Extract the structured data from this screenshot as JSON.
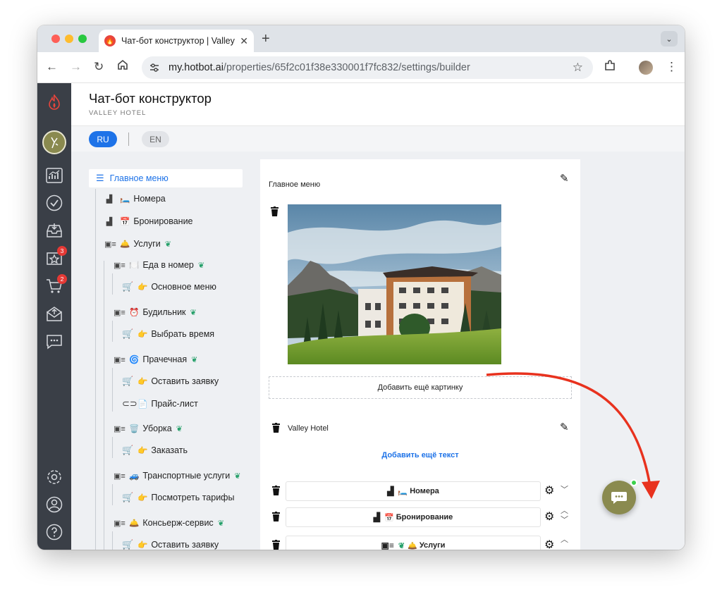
{
  "browser": {
    "tab_title": "Чат-бот конструктор | Valley",
    "url_host": "my.hotbot.ai",
    "url_path": "/properties/65f2c01f38e330001f7fc832/settings/builder"
  },
  "sidebar": {
    "badges": {
      "favorites": "3",
      "cart": "2"
    }
  },
  "header": {
    "title": "Чат-бот конструктор",
    "subtitle": "VALLEY HOTEL"
  },
  "languages": {
    "active": "RU",
    "inactive": "EN"
  },
  "tree": {
    "root": "Главное меню",
    "items": [
      {
        "emoji": "🛏️",
        "label": "Номера"
      },
      {
        "emoji": "📅",
        "label": "Бронирование"
      },
      {
        "emoji": "🛎️",
        "label": "Услуги"
      },
      {
        "emoji": "🍽️",
        "label": "Еда в номер"
      },
      {
        "emoji": "👉",
        "label": "Основное меню"
      },
      {
        "emoji": "⏰",
        "label": "Будильник"
      },
      {
        "emoji": "👉",
        "label": "Выбрать время"
      },
      {
        "emoji": "🌀",
        "label": "Прачечная"
      },
      {
        "emoji": "👉",
        "label": "Оставить заявку"
      },
      {
        "emoji": "📄",
        "label": "Прайс-лист"
      },
      {
        "emoji": "🗑️",
        "label": "Уборка"
      },
      {
        "emoji": "👉",
        "label": "Заказать"
      },
      {
        "emoji": "🚙",
        "label": "Транспортные услуги"
      },
      {
        "emoji": "👉",
        "label": "Посмотреть тарифы"
      },
      {
        "emoji": "🛎️",
        "label": "Консьерж-сервис"
      },
      {
        "emoji": "👉",
        "label": "Оставить заявку"
      }
    ]
  },
  "editor": {
    "title": "Главное меню",
    "add_image": "Добавить ещё картинку",
    "text_block": "Valley Hotel",
    "add_text": "Добавить ещё текст",
    "buttons": [
      {
        "emoji": "🛏️",
        "label": "Номера"
      },
      {
        "emoji": "📅",
        "label": "Бронирование"
      },
      {
        "emoji": "🛎️",
        "label": "Услуги"
      }
    ]
  },
  "colors": {
    "accent": "#1e73e8",
    "sidebar": "#3a3f47",
    "chat_fab": "#8a8a4f",
    "annotation_arrow": "#e8321e"
  }
}
